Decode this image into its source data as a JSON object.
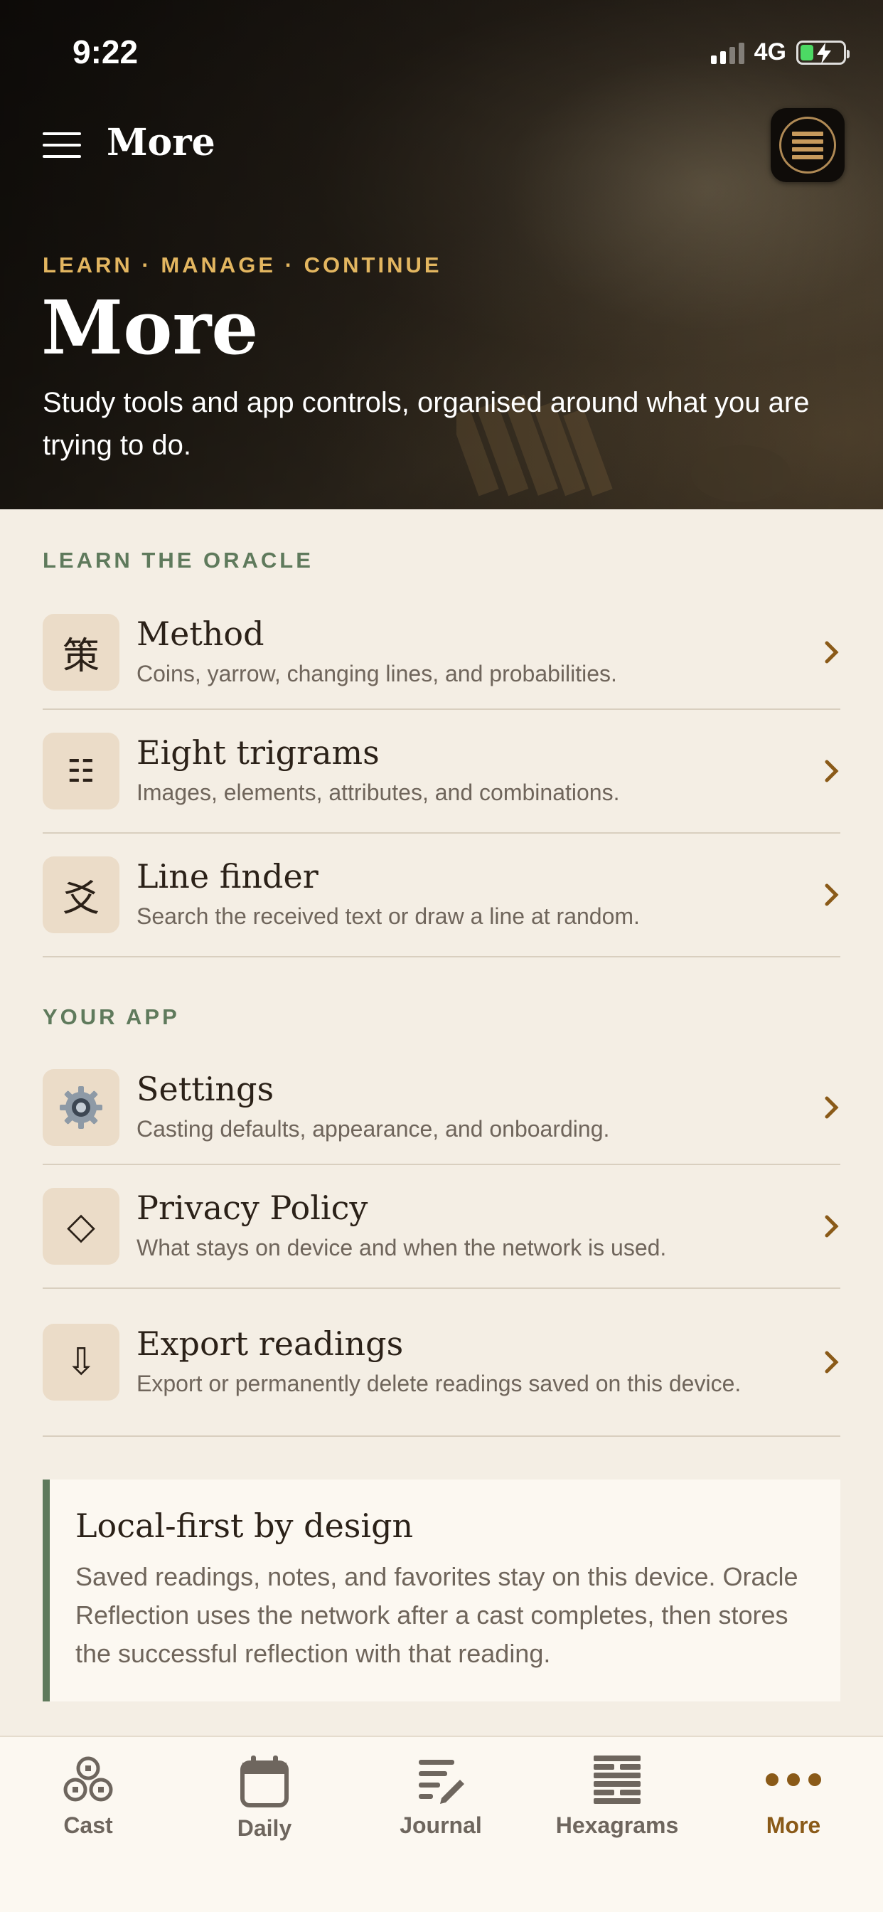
{
  "status_bar": {
    "time": "9:22",
    "network": "4G"
  },
  "nav": {
    "title": "More",
    "menu_icon": "hamburger-icon",
    "logo_icon": "hexagram-logo-icon"
  },
  "hero": {
    "kicker": "LEARN · MANAGE · CONTINUE",
    "title": "More",
    "subtitle": "Study tools and app controls, organised around what you are trying to do."
  },
  "learn": {
    "label": "LEARN THE ORACLE",
    "items": [
      {
        "icon_glyph": "策",
        "title": "Method",
        "description": "Coins, yarrow, changing lines, and probabilities."
      },
      {
        "icon_glyph": "☷",
        "title": "Eight trigrams",
        "description": "Images, elements, attributes, and combinations."
      },
      {
        "icon_glyph": "爻",
        "title": "Line finder",
        "description": "Search the received text or draw a line at random."
      }
    ]
  },
  "app": {
    "label": "YOUR APP",
    "items": [
      {
        "icon": "gear-icon",
        "title": "Settings",
        "description": "Casting defaults, appearance, and onboarding."
      },
      {
        "icon_glyph": "◇",
        "title": "Privacy Policy",
        "description": "What stays on device and when the network is used."
      },
      {
        "icon_glyph": "⇩",
        "title": "Export readings",
        "description": "Export or permanently delete readings saved on this device."
      }
    ]
  },
  "note": {
    "title": "Local-first by design",
    "body": "Saved readings, notes, and favorites stay on this device. Oracle Reflection uses the network after a cast completes, then stores the successful reflection with that reading."
  },
  "tabbar": {
    "active": "More",
    "tabs": [
      {
        "label": "Cast",
        "icon": "coins-icon"
      },
      {
        "label": "Daily",
        "icon": "calendar-icon"
      },
      {
        "label": "Journal",
        "icon": "journal-icon"
      },
      {
        "label": "Hexagrams",
        "icon": "hexagram-icon"
      },
      {
        "label": "More",
        "icon": "ellipsis-icon"
      }
    ]
  },
  "colors": {
    "accent_gold": "#e3b660",
    "section_green": "#5f7a5c",
    "chevron_brown": "#8a5a18",
    "background": "#f4eee4"
  }
}
